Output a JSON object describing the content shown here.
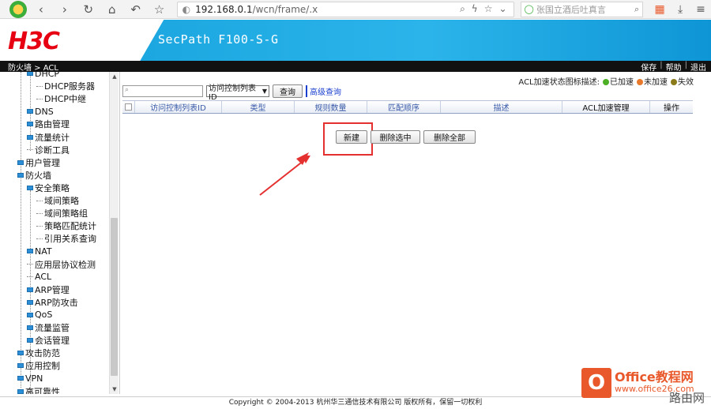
{
  "browser": {
    "url_host": "192.168.0.1",
    "url_path": "/wcn/frame/.x",
    "search_placeholder": "张国立酒后吐真言"
  },
  "header": {
    "logo": "H3C",
    "product": "SecPath F100-S-G"
  },
  "crumb": {
    "path": "防火墙 > ACL",
    "links": [
      "保存",
      "帮助",
      "退出"
    ]
  },
  "sidebar": {
    "items": [
      {
        "label": "DHCP",
        "type": "folder"
      },
      {
        "label": "DHCP服务器",
        "type": "leaf"
      },
      {
        "label": "DHCP中继",
        "type": "leaf"
      },
      {
        "label": "DNS",
        "type": "folder"
      },
      {
        "label": "路由管理",
        "type": "folder"
      },
      {
        "label": "流量统计",
        "type": "folder"
      },
      {
        "label": "诊断工具",
        "type": "leaf"
      },
      {
        "label": "用户管理",
        "type": "folder"
      },
      {
        "label": "防火墙",
        "type": "folder"
      },
      {
        "label": "安全策略",
        "type": "folder"
      },
      {
        "label": "域间策略",
        "type": "leaf"
      },
      {
        "label": "域间策略组",
        "type": "leaf"
      },
      {
        "label": "策略匹配统计",
        "type": "leaf"
      },
      {
        "label": "引用关系查询",
        "type": "leaf"
      },
      {
        "label": "NAT",
        "type": "folder"
      },
      {
        "label": "应用层协议检测",
        "type": "leaf"
      },
      {
        "label": "ACL",
        "type": "leaf"
      },
      {
        "label": "ARP管理",
        "type": "folder"
      },
      {
        "label": "ARP防攻击",
        "type": "folder"
      },
      {
        "label": "QoS",
        "type": "folder"
      },
      {
        "label": "流量监管",
        "type": "folder"
      },
      {
        "label": "会话管理",
        "type": "folder"
      },
      {
        "label": "攻击防范",
        "type": "folder"
      },
      {
        "label": "应用控制",
        "type": "folder"
      },
      {
        "label": "VPN",
        "type": "folder"
      },
      {
        "label": "高可靠性",
        "type": "folder"
      }
    ]
  },
  "main": {
    "legend_label": "ACL加速状态图标描述:",
    "legend": [
      {
        "label": "已加速",
        "color": "#4caf24"
      },
      {
        "label": "未加速",
        "color": "#e8792a"
      },
      {
        "label": "失效",
        "color": "#8a7a1a"
      }
    ],
    "select_value": "访问控制列表ID",
    "query_button": "查询",
    "advanced_query": "高级查询",
    "columns": [
      "访问控制列表ID",
      "类型",
      "规则数量",
      "匹配顺序",
      "描述",
      "ACL加速管理",
      "操作"
    ],
    "buttons": {
      "new": "新建",
      "delete_selected": "删除选中",
      "delete_all": "删除全部"
    }
  },
  "footer": {
    "copyright": "Copyright © 2004-2013 杭州华三通信技术有限公司 版权所有，保留一切权利"
  },
  "watermark": {
    "brand": "Office教程网",
    "url": "www.office26.com",
    "logo_letter": "O",
    "signature": "路由网"
  },
  "colors": {
    "accent": "#1aa5df",
    "brand_red": "#e60012",
    "highlight": "#e53030"
  }
}
